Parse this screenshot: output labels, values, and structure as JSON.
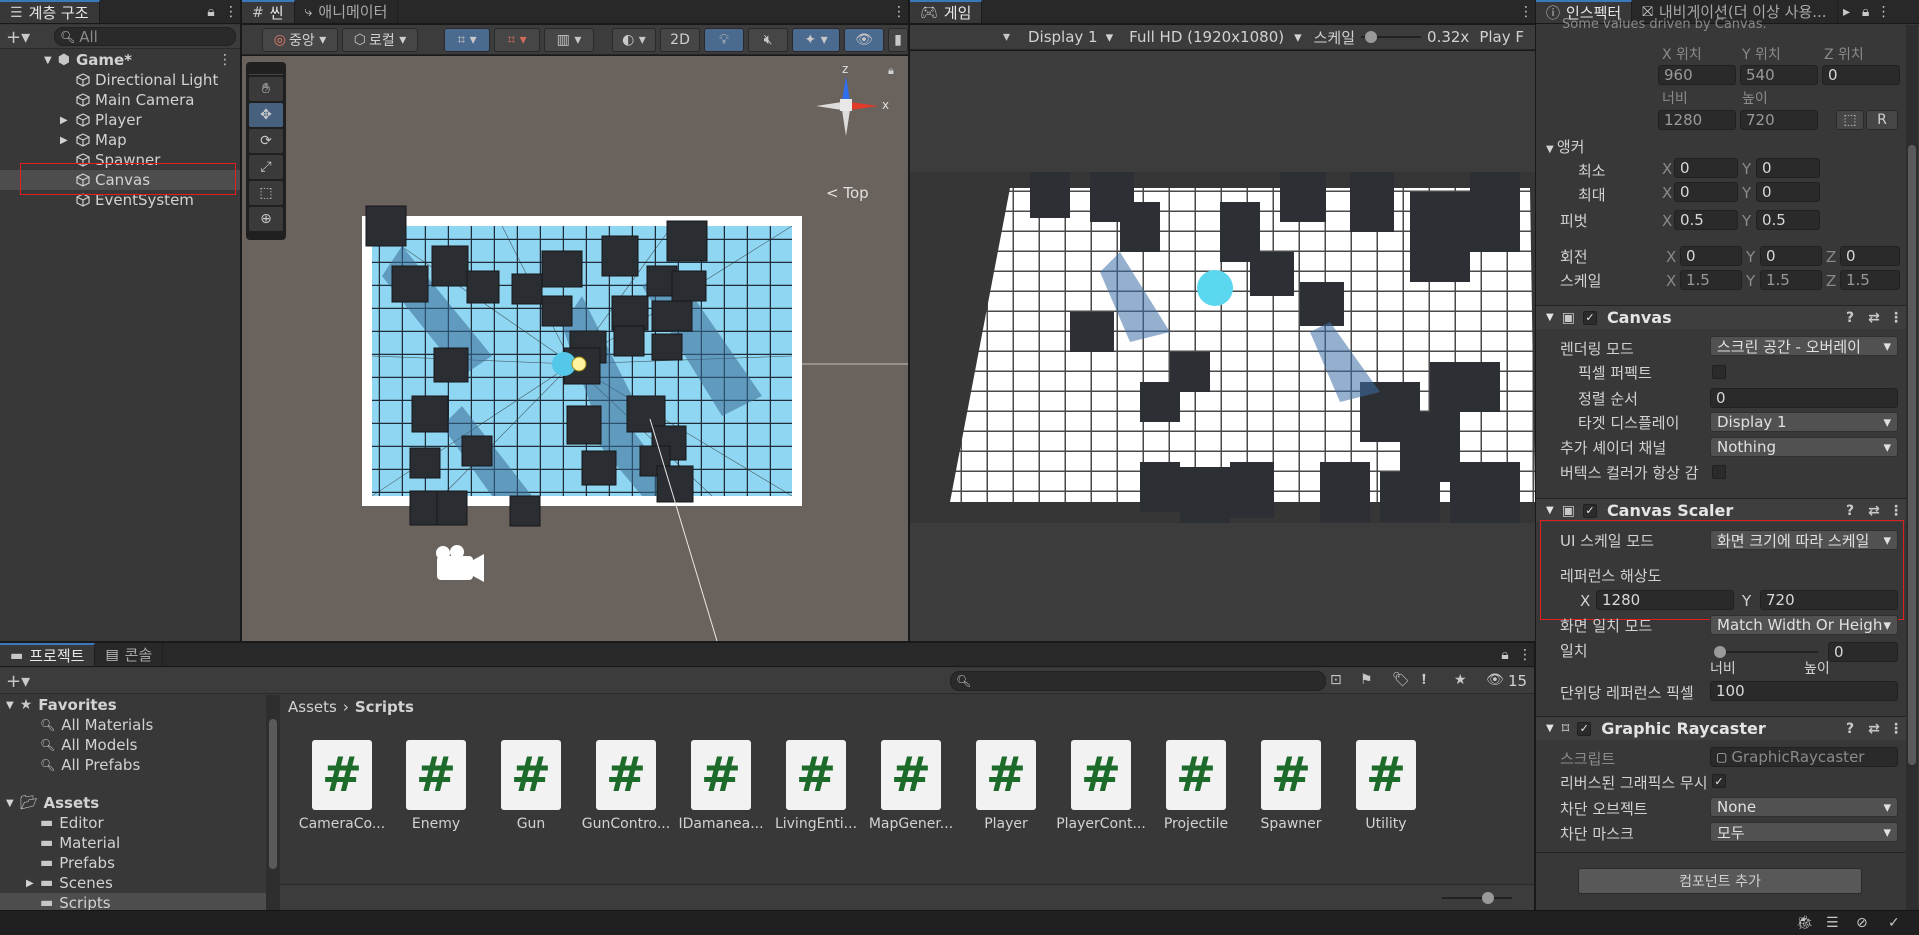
{
  "hierarchy": {
    "tab_label": "계층 구조",
    "search_placeholder": "All",
    "scene_name": "Game*",
    "items": [
      {
        "label": "Directional Light"
      },
      {
        "label": "Main Camera"
      },
      {
        "label": "Player"
      },
      {
        "label": "Map"
      },
      {
        "label": "Spawner"
      },
      {
        "label": "Canvas"
      },
      {
        "label": "EventSystem"
      }
    ]
  },
  "scene": {
    "tab_label": "씬",
    "anim_tab_label": "애니메이터",
    "pivot_label": "중앙",
    "space_label": "로컬",
    "mode_2d": "2D",
    "gizmo_top_label": "< Top",
    "axes": {
      "x": "x",
      "z": "z"
    }
  },
  "game": {
    "tab_label": "게임",
    "display": "Display 1",
    "resolution": "Full HD (1920x1080)",
    "scale_label": "스케일",
    "scale_value": "0.32x",
    "play_label": "Play F"
  },
  "inspector": {
    "tab_label": "인스펙터",
    "nav_tab_label": "내비게이션(더 이상 사용...",
    "note": "Some values driven by Canvas.",
    "rect": {
      "pos_x_label": "X 위치",
      "pos_y_label": "Y 위치",
      "pos_z_label": "Z 위치",
      "pos_x": "960",
      "pos_y": "540",
      "pos_z": "0",
      "width_label": "너비",
      "height_label": "높이",
      "width": "1280",
      "height": "720",
      "r_label": "R"
    },
    "anchor": {
      "title": "앵커",
      "min_label": "최소",
      "max_label": "최대",
      "min_x": "0",
      "min_y": "0",
      "max_x": "0",
      "max_y": "0"
    },
    "pivot": {
      "label": "피벗",
      "x": "0.5",
      "y": "0.5"
    },
    "rotation": {
      "label": "회전",
      "x": "0",
      "y": "0",
      "z": "0"
    },
    "scale": {
      "label": "스케일",
      "x": "1.5",
      "y": "1.5",
      "z": "1.5"
    },
    "axis": {
      "x": "X",
      "y": "Y",
      "z": "Z"
    },
    "canvas": {
      "title": "Canvas",
      "render_mode_label": "렌더링 모드",
      "render_mode": "스크린 공간 - 오버레이",
      "pixel_perfect_label": "픽셀 퍼펙트",
      "sort_order_label": "정렬 순서",
      "sort_order": "0",
      "target_display_label": "타겟 디스플레이",
      "target_display": "Display 1",
      "shader_channels_label": "추가 셰이더 채널",
      "shader_channels": "Nothing",
      "vertex_color_label": "버텍스 컬러가 항상 감"
    },
    "scaler": {
      "title": "Canvas Scaler",
      "ui_scale_mode_label": "UI 스케일 모드",
      "ui_scale_mode": "화면 크기에 따라 스케일",
      "ref_res_label": "레퍼런스 해상도",
      "ref_x": "1280",
      "ref_y": "720",
      "screen_match_label": "화면 일치 모드",
      "screen_match": "Match Width Or Heigh",
      "match_label": "일치",
      "match_value": "0",
      "width_label": "너비",
      "height_label": "높이",
      "ppu_label": "단위당 레퍼런스 픽셀",
      "ppu": "100"
    },
    "raycaster": {
      "title": "Graphic Raycaster",
      "script_label": "스크립트",
      "script": "GraphicRaycaster",
      "reversed_label": "리버스된 그래픽스 무시",
      "blocking_objects_label": "차단 오브젝트",
      "blocking_objects": "None",
      "blocking_mask_label": "차단 마스크",
      "blocking_mask": "모두"
    },
    "add_component": "컴포넌트 추가"
  },
  "project": {
    "tab_label": "프로젝트",
    "console_tab_label": "콘솔",
    "hidden_count": "15",
    "favorites_label": "Favorites",
    "favorites": [
      "All Materials",
      "All Models",
      "All Prefabs"
    ],
    "assets_label": "Assets",
    "folders": [
      "Editor",
      "Material",
      "Prefabs",
      "Scenes",
      "Scripts"
    ],
    "breadcrumb_root": "Assets",
    "breadcrumb_current": "Scripts",
    "script_glyph": "#",
    "scripts": [
      "CameraCo...",
      "Enemy",
      "Gun",
      "GunContro...",
      "IDamanea...",
      "LivingEnti...",
      "MapGener...",
      "Player",
      "PlayerCont...",
      "Projectile",
      "Spawner",
      "Utility"
    ]
  },
  "colors": {
    "accent": "#3a79bb",
    "highlight_box": "#e02020",
    "floor_blue": "#8fd6f2",
    "script_hash": "#1d6b2a"
  }
}
